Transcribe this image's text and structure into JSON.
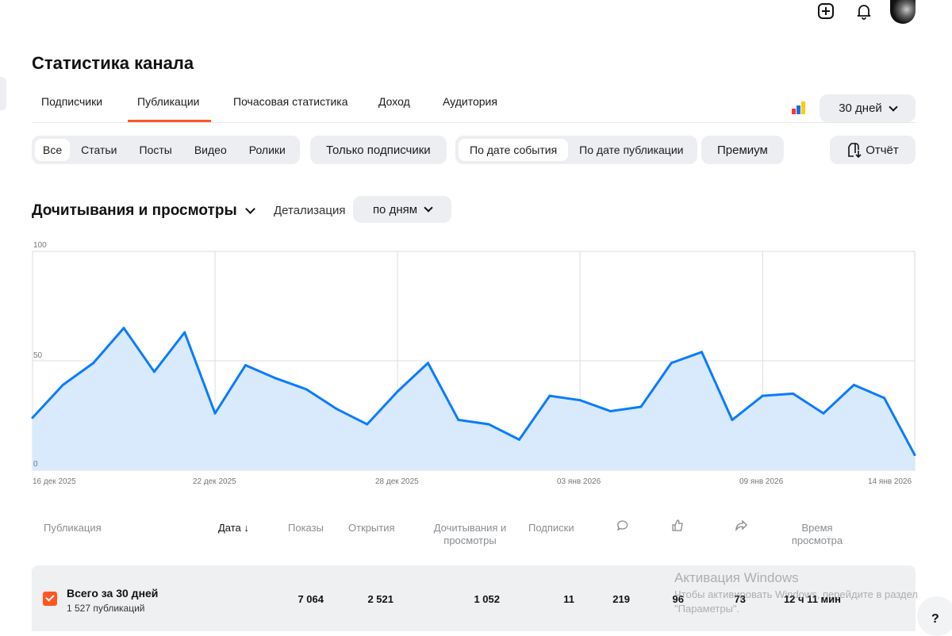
{
  "header": {
    "icons": [
      "add-square-icon",
      "bell-icon",
      "avatar"
    ]
  },
  "page_title": "Статистика канала",
  "tabs": [
    {
      "label": "Подписчики"
    },
    {
      "label": "Публикации",
      "active": true
    },
    {
      "label": "Почасовая статистика"
    },
    {
      "label": "Доход"
    },
    {
      "label": "Аудитория"
    }
  ],
  "period": {
    "label": "30 дней"
  },
  "filters": {
    "types": [
      {
        "label": "Все",
        "active": true
      },
      {
        "label": "Статьи"
      },
      {
        "label": "Посты"
      },
      {
        "label": "Видео"
      },
      {
        "label": "Ролики"
      }
    ],
    "subscribers_only": "Только подписчики",
    "date_modes": [
      {
        "label": "По дате события",
        "active": true
      },
      {
        "label": "По дате публикации"
      }
    ],
    "premium": "Премиум",
    "report": "Отчёт"
  },
  "metric": {
    "label": "Дочитывания и просмотры",
    "detail_label": "Детализация",
    "detail_value": "по дням"
  },
  "accent": "#ff5722",
  "chart_data": {
    "type": "area",
    "x": [
      "16 дек 2025",
      "17 дек 2025",
      "18 дек 2025",
      "19 дек 2025",
      "20 дек 2025",
      "21 дек 2025",
      "22 дек 2025",
      "23 дек 2025",
      "24 дек 2025",
      "25 дек 2025",
      "26 дек 2025",
      "27 дек 2025",
      "28 дек 2025",
      "29 дек 2025",
      "30 дек 2025",
      "31 дек 2025",
      "01 янв 2026",
      "02 янв 2026",
      "03 янв 2026",
      "04 янв 2026",
      "05 янв 2026",
      "06 янв 2026",
      "07 янв 2026",
      "08 янв 2026",
      "09 янв 2026",
      "10 янв 2026",
      "11 янв 2026",
      "12 янв 2026",
      "13 янв 2026",
      "14 янв 2026"
    ],
    "values": [
      24,
      39,
      49,
      65,
      45,
      63,
      26,
      48,
      42,
      37,
      28,
      21,
      36,
      49,
      23,
      21,
      14,
      34,
      32,
      27,
      29,
      49,
      54,
      23,
      34,
      35,
      26,
      39,
      33,
      7
    ],
    "x_tick_labels": [
      "16 дек 2025",
      "22 дек 2025",
      "28 дек 2025",
      "03 янв 2026",
      "09 янв 2026",
      "14 янв 2026"
    ],
    "y_tick_labels": [
      "100",
      "50",
      "0"
    ],
    "ylim": [
      0,
      100
    ],
    "grid": true,
    "line_color": "#0a7cff",
    "fill_color": "#d9eafc"
  },
  "table": {
    "headers": {
      "publication": "Публикация",
      "date": "Дата ↓",
      "shows": "Показы",
      "opens": "Открытия",
      "reads": "Дочитывания и просмотры",
      "subs": "Подписки",
      "time": "Время просмотра"
    },
    "header_icons": [
      "comment-icon",
      "like-icon",
      "share-icon"
    ],
    "total": {
      "title": "Всего за 30 дней",
      "subtitle": "1 527 публикаций",
      "shows": "7 064",
      "opens": "2 521",
      "reads": "1 052",
      "subs": "11",
      "comments": "219",
      "likes": "96",
      "shares": "73",
      "time": "12 ч 11 мин"
    }
  },
  "watermark": {
    "title": "Активация Windows",
    "text": "Чтобы активировать Windows, перейдите в раздел \"Параметры\"."
  },
  "help": "?"
}
